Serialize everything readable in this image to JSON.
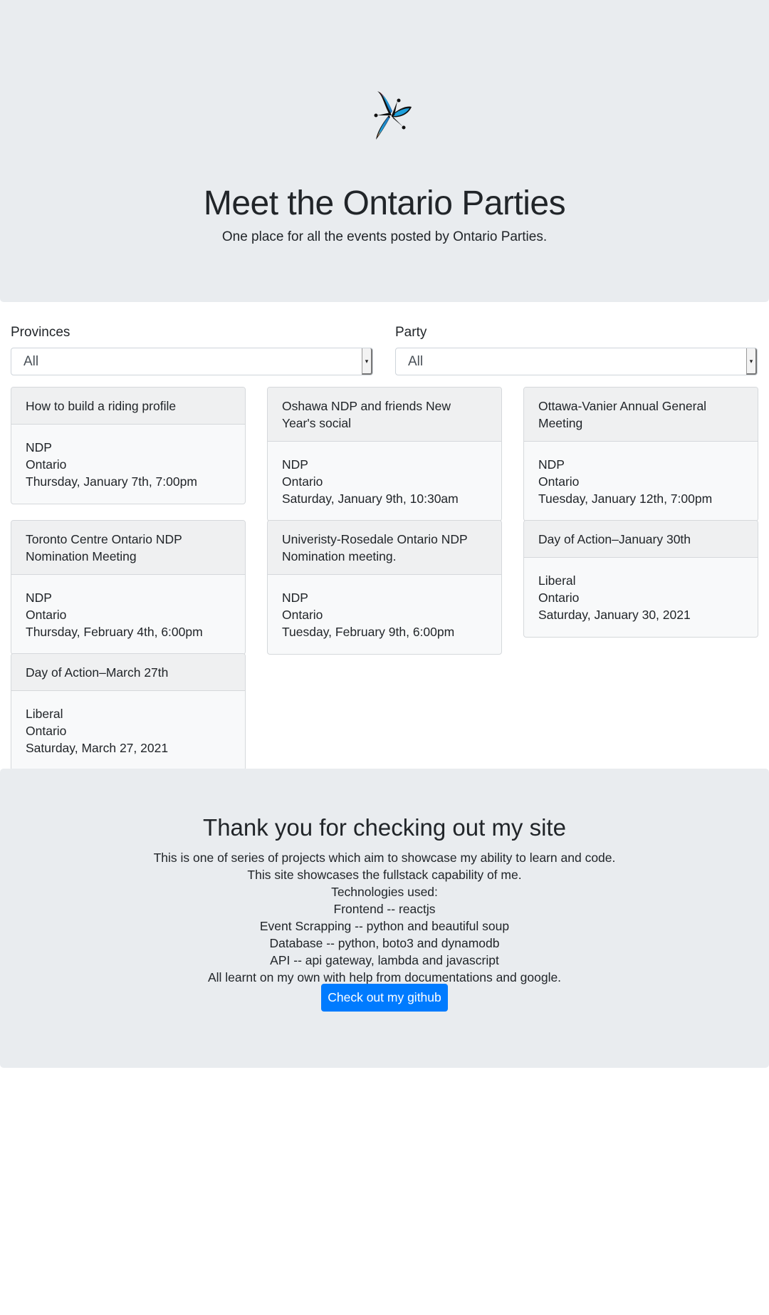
{
  "hero": {
    "title": "Meet the Ontario Parties",
    "subtitle": "One place for all the events posted by Ontario Parties.",
    "logo_icon": "ontario-trillium-logo-icon"
  },
  "filters": {
    "provinces": {
      "label": "Provinces",
      "value": "All"
    },
    "party": {
      "label": "Party",
      "value": "All"
    }
  },
  "events": [
    {
      "title": "How to build a riding profile",
      "party": "NDP",
      "province": "Ontario",
      "date": "Thursday, January 7th, 7:00pm"
    },
    {
      "title": "Oshawa NDP and friends New Year's social",
      "party": "NDP",
      "province": "Ontario",
      "date": "Saturday, January 9th, 10:30am"
    },
    {
      "title": "Ottawa-Vanier Annual General Meeting",
      "party": "NDP",
      "province": "Ontario",
      "date": "Tuesday, January 12th, 7:00pm"
    },
    {
      "title": "Toronto Centre Ontario NDP Nomination Meeting",
      "party": "NDP",
      "province": "Ontario",
      "date": "Thursday, February 4th, 6:00pm"
    },
    {
      "title": "Univeristy-Rosedale Ontario NDP Nomination meeting.",
      "party": "NDP",
      "province": "Ontario",
      "date": "Tuesday, February 9th, 6:00pm"
    },
    {
      "title": "Day of Action–January 30th",
      "party": "Liberal",
      "province": "Ontario",
      "date": "Saturday, January 30, 2021"
    },
    {
      "title": "Day of Action–March 27th",
      "party": "Liberal",
      "province": "Ontario",
      "date": "Saturday, March 27, 2021"
    }
  ],
  "footer": {
    "title": "Thank you for checking out my site",
    "lines": [
      "This is one of series of projects which aim to showcase my ability to learn and code.",
      "This site showcases the fullstack capability of me.",
      "Technologies used:",
      "Frontend -- reactjs",
      "Event Scrapping -- python and beautiful soup",
      "Database -- python, boto3 and dynamodb",
      "API -- api gateway, lambda and javascript",
      "All learnt on my own with help from documentations and google."
    ],
    "button_label": "Check out my github",
    "button_color": "#007bff"
  }
}
